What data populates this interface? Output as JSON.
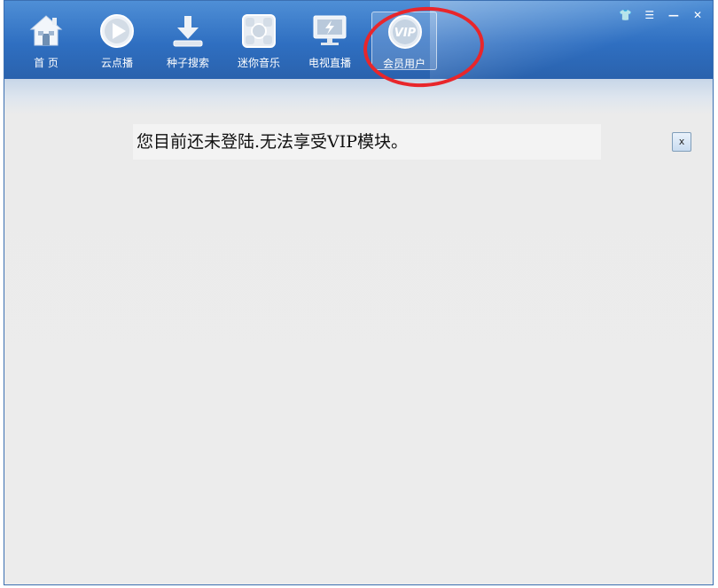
{
  "nav": {
    "items": [
      {
        "label": "首 页",
        "icon": "home-icon"
      },
      {
        "label": "云点播",
        "icon": "play-icon"
      },
      {
        "label": "种子搜索",
        "icon": "download-icon"
      },
      {
        "label": "迷你音乐",
        "icon": "music-icon"
      },
      {
        "label": "电视直播",
        "icon": "tv-icon"
      },
      {
        "label": "会员用户",
        "icon": "vip-icon",
        "active": true
      }
    ]
  },
  "window_controls": {
    "skin": "👕",
    "menu": "☰",
    "minimize": "—",
    "close": "✕"
  },
  "vip_icon_text": "VIP",
  "main": {
    "notice": "您目前还未登陆.无法享受VIP模块。",
    "close_label": "x"
  },
  "colors": {
    "titlebar": "#2f6fc1",
    "annotation": "#e8262b"
  }
}
